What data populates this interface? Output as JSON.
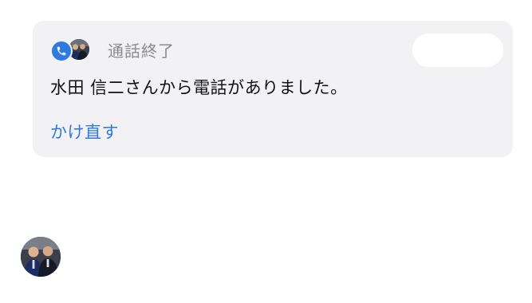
{
  "call_card": {
    "status_title": "通話終了",
    "message": "水田 信二さんから電話がありました。",
    "callback_label": "かけ直す"
  },
  "icons": {
    "call_status": "phone-icon",
    "caller_avatar": "avatar"
  },
  "colors": {
    "accent": "#2d7be0",
    "card_background": "#f2f2f4",
    "muted_text": "#8a8a8e",
    "body_text": "#111111"
  }
}
